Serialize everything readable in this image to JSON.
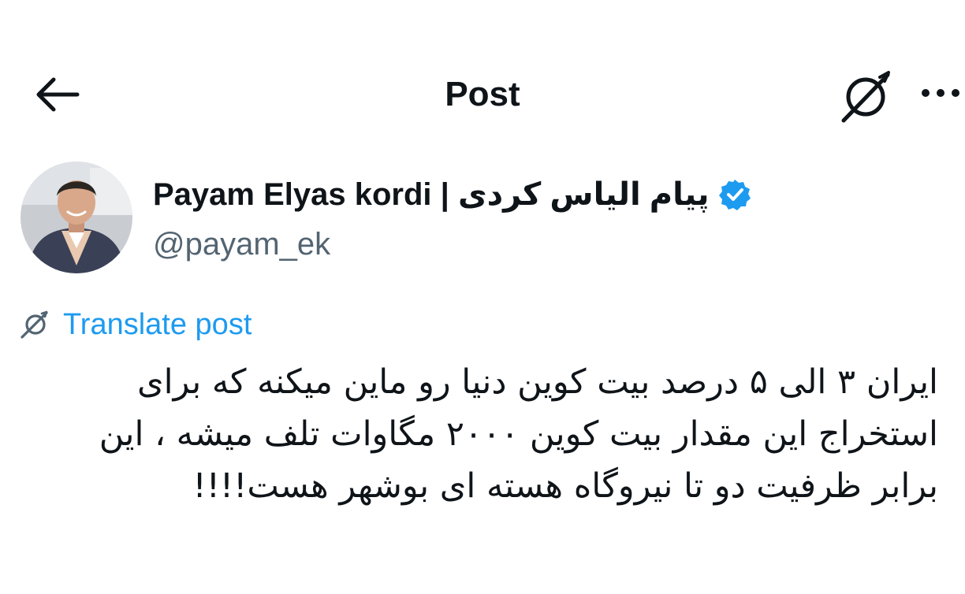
{
  "header": {
    "title": "Post",
    "back_icon": "arrow-left-icon",
    "grok_icon": "grok-icon",
    "more_icon": "more-horizontal-icon"
  },
  "author": {
    "name": "Payam Elyas kordi | پیام الیاس کردی",
    "handle": "@payam_ek",
    "verified": true,
    "verified_color": "#1d9bf0"
  },
  "translate": {
    "label": "Translate post",
    "icon": "grok-icon"
  },
  "tweet": {
    "lines": [
      "ایران ۳ الی ۵ درصد بیت کوین دنیا رو ماین میکنه که برای",
      "استخراج این مقدار بیت کوین ۲۰۰۰ مگاوات تلف میشه ، این",
      "برابر ظرفیت دو تا نیروگاه هسته ای بوشهر هست!!!!"
    ]
  },
  "colors": {
    "text": "#0f1419",
    "secondary": "#536471",
    "link": "#1d9bf0"
  }
}
